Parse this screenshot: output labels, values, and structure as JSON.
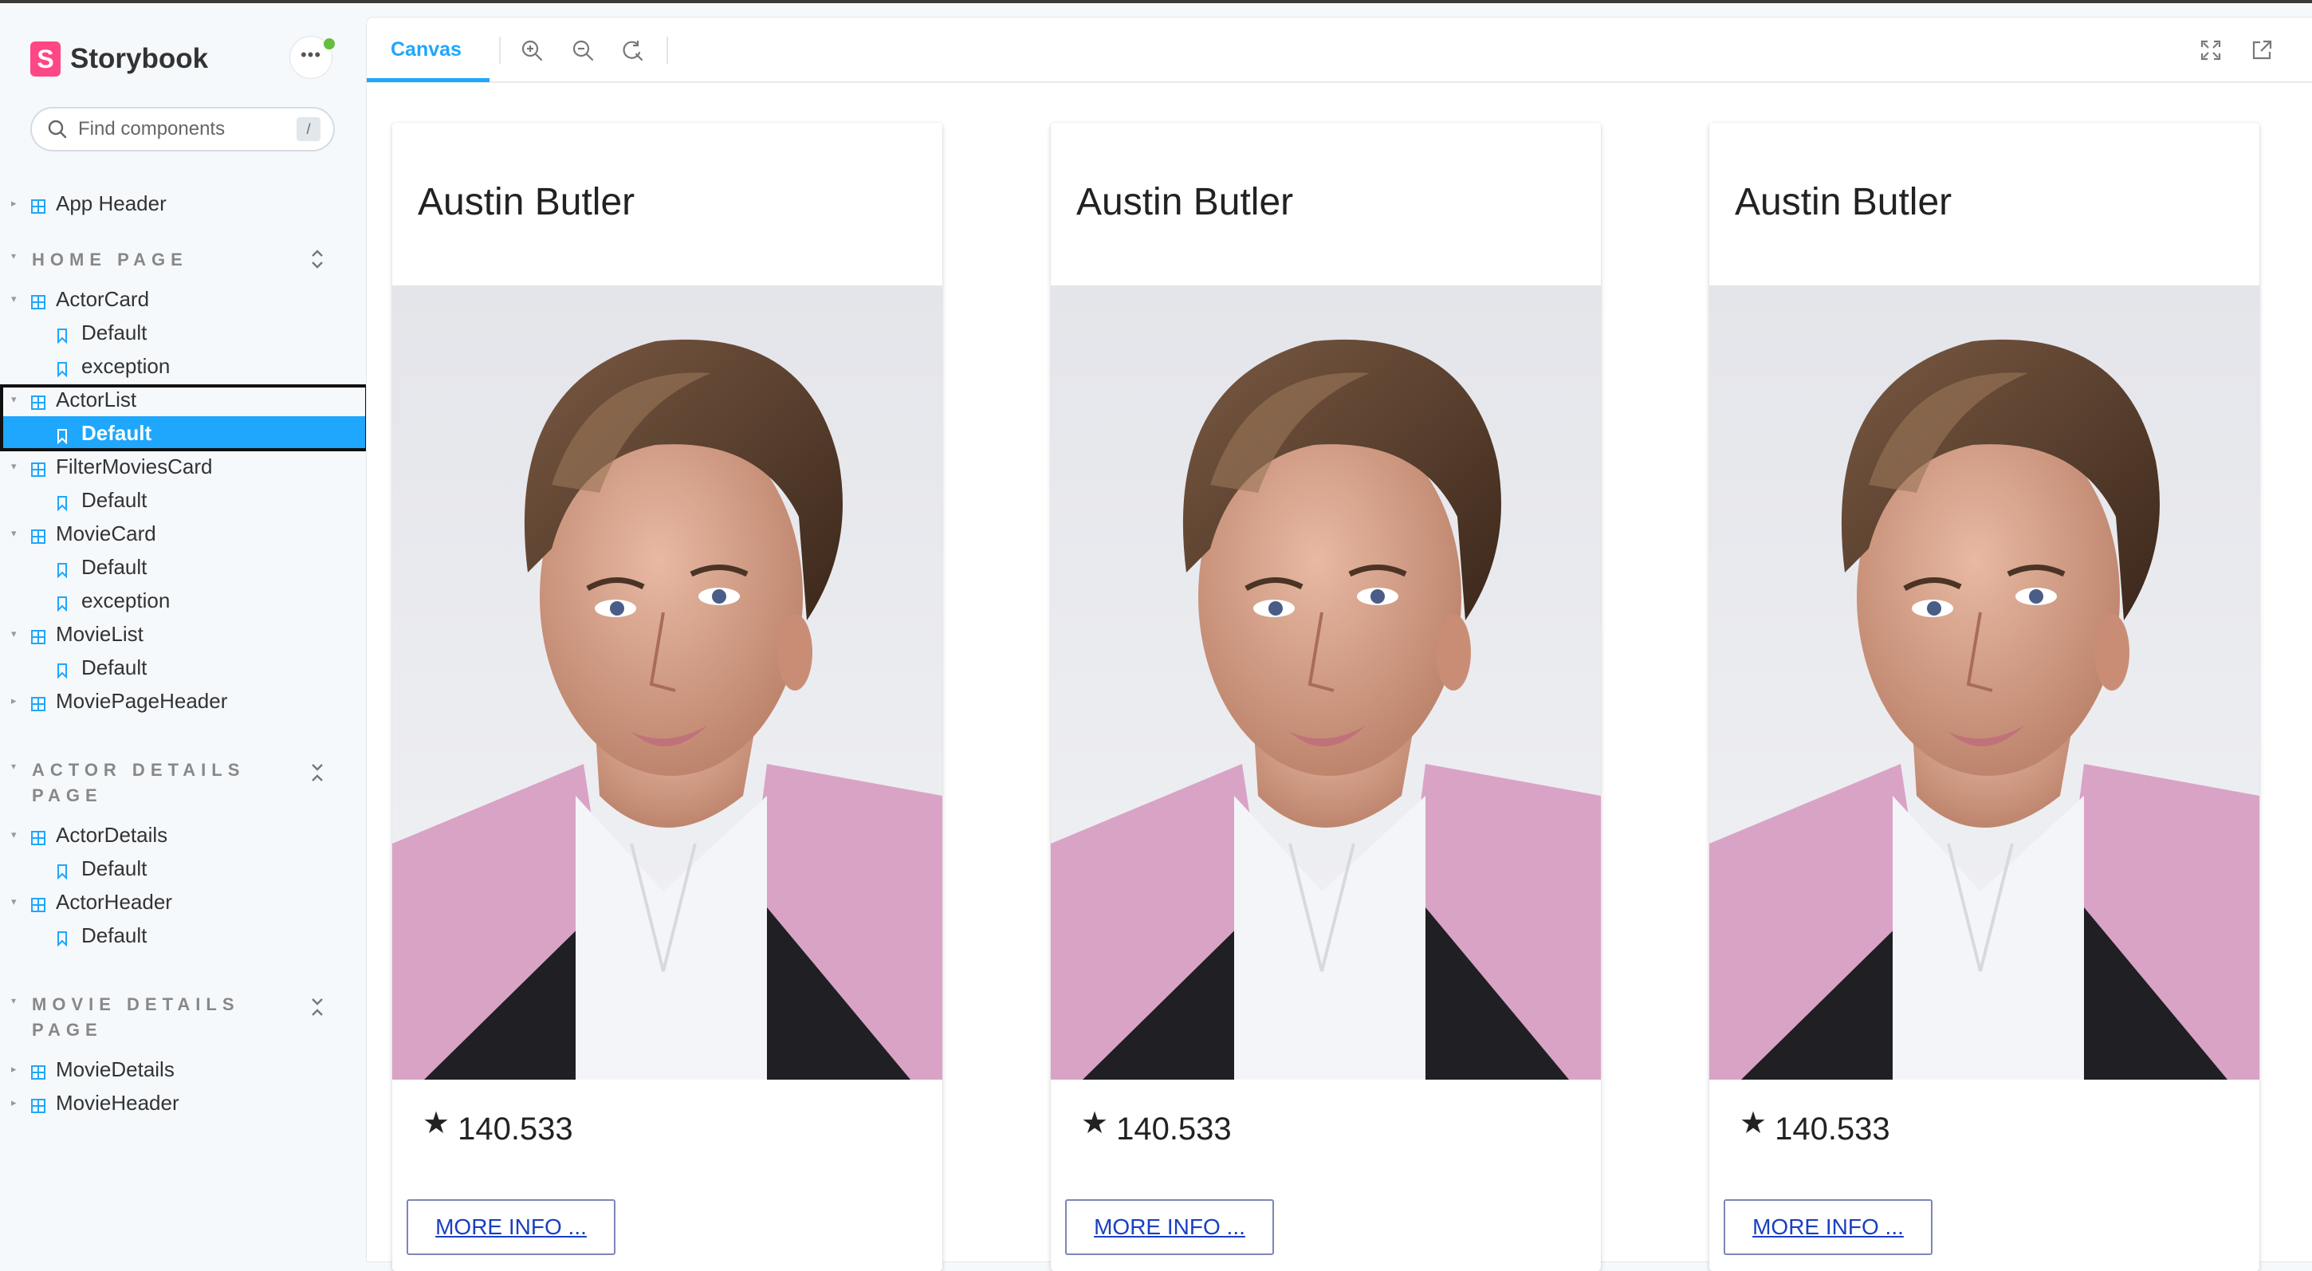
{
  "app": {
    "brand": "Storybook",
    "more_icon": "ellipsis-icon",
    "search": {
      "placeholder": "Find components",
      "shortcut": "/"
    }
  },
  "sidebar": {
    "root_items": [
      {
        "label": "App Header",
        "type": "component",
        "expanded": false
      }
    ],
    "sections": [
      {
        "title": "HOME PAGE",
        "title_lines": [
          "HOME PAGE"
        ],
        "items": [
          {
            "label": "ActorCard",
            "stories": [
              "Default",
              "exception"
            ]
          },
          {
            "label": "ActorList",
            "stories": [
              "Default"
            ],
            "selected_story": "Default"
          },
          {
            "label": "FilterMoviesCard",
            "stories": [
              "Default"
            ]
          },
          {
            "label": "MovieCard",
            "stories": [
              "Default",
              "exception"
            ]
          },
          {
            "label": "MovieList",
            "stories": [
              "Default"
            ]
          },
          {
            "label": "MoviePageHeader",
            "stories": []
          }
        ]
      },
      {
        "title": "ACTOR DETAILS PAGE",
        "title_lines": [
          "ACTOR DETAILS",
          "PAGE"
        ],
        "items": [
          {
            "label": "ActorDetails",
            "stories": [
              "Default"
            ]
          },
          {
            "label": "ActorHeader",
            "stories": [
              "Default"
            ]
          }
        ]
      },
      {
        "title": "MOVIE DETAILS PAGE",
        "title_lines": [
          "MOVIE DETAILS",
          "PAGE"
        ],
        "items": [
          {
            "label": "MovieDetails",
            "stories": []
          },
          {
            "label": "MovieHeader",
            "stories": []
          }
        ]
      }
    ]
  },
  "toolbar": {
    "tab": "Canvas",
    "icons": [
      "zoom-in-icon",
      "zoom-out-icon",
      "reset-zoom-icon",
      "fullscreen-icon",
      "open-new-tab-icon"
    ]
  },
  "cards": [
    {
      "name": "Austin Butler",
      "rating": "140.533",
      "button": "MORE INFO ..."
    },
    {
      "name": "Austin Butler",
      "rating": "140.533",
      "button": "MORE INFO ..."
    },
    {
      "name": "Austin Butler",
      "rating": "140.533",
      "button": "MORE INFO ..."
    }
  ],
  "colors": {
    "accent": "#1ea7fd",
    "brand": "#ff4785",
    "status": "#66bf3c",
    "link": "#1a3fbf",
    "jacket": "#d9a3c6"
  }
}
